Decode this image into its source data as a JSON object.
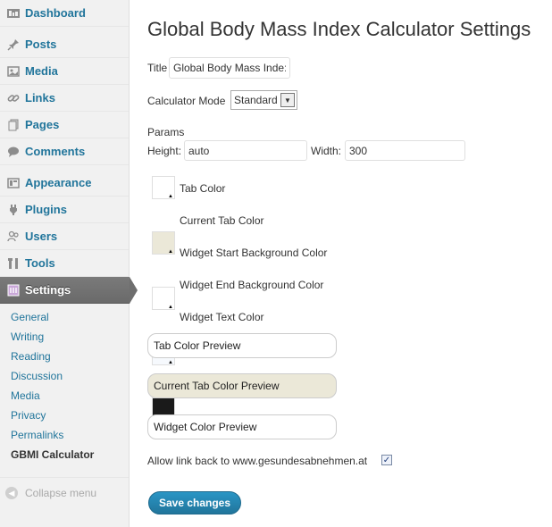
{
  "sidebar": {
    "items": [
      {
        "label": "Dashboard",
        "icon": "dashboard-icon"
      },
      {
        "label": "Posts",
        "icon": "pin-icon"
      },
      {
        "label": "Media",
        "icon": "media-icon"
      },
      {
        "label": "Links",
        "icon": "link-icon"
      },
      {
        "label": "Pages",
        "icon": "pages-icon"
      },
      {
        "label": "Comments",
        "icon": "comment-icon"
      },
      {
        "label": "Appearance",
        "icon": "appearance-icon"
      },
      {
        "label": "Plugins",
        "icon": "plugin-icon"
      },
      {
        "label": "Users",
        "icon": "users-icon"
      },
      {
        "label": "Tools",
        "icon": "tools-icon"
      },
      {
        "label": "Settings",
        "icon": "settings-icon"
      }
    ],
    "submenu": [
      {
        "label": "General"
      },
      {
        "label": "Writing"
      },
      {
        "label": "Reading"
      },
      {
        "label": "Discussion"
      },
      {
        "label": "Media"
      },
      {
        "label": "Privacy"
      },
      {
        "label": "Permalinks"
      },
      {
        "label": "GBMI Calculator"
      }
    ],
    "collapse_label": "Collapse menu"
  },
  "page": {
    "title": "Global Body Mass Index Calculator Settings",
    "title_label": "Title",
    "title_value": "Global Body Mass Inde:",
    "mode_label": "Calculator Mode",
    "mode_value": "Standard",
    "params_label": "Params",
    "height_label": "Height:",
    "height_value": "auto",
    "width_label": "Width:",
    "width_value": "300",
    "colors": [
      {
        "label": "Tab Color",
        "color": "#ffffff"
      },
      {
        "label": "Current Tab Color",
        "color": "#ebe8d8"
      },
      {
        "label": "Widget Start Background Color",
        "color": "#ffffff"
      },
      {
        "label": "Widget End Background Color",
        "color": "#f6f9fd"
      },
      {
        "label": "Widget Text Color",
        "color": "#1a1a1a"
      }
    ],
    "previews": [
      {
        "label": "Tab Color Preview",
        "color": "#ffffff"
      },
      {
        "label": "Current Tab Color Preview",
        "color": "#ebe8d8"
      },
      {
        "label": "Widget Color Preview",
        "color": "#ffffff"
      }
    ],
    "link_back_label": "Allow link back to www.gesundesabnehmen.at",
    "link_back_checked": "✓",
    "save_label": "Save changes"
  }
}
